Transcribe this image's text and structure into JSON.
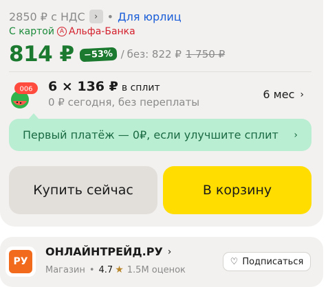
{
  "legal": {
    "price": "2850 ₽ с НДС",
    "link": "Для юрлиц",
    "separator": "•"
  },
  "bank_offer": {
    "prefix": "С картой",
    "bank_name": "Альфа-Банка"
  },
  "price": {
    "main": "814 ₽",
    "discount_badge": "−53%",
    "separator": "/",
    "without_label": "без: 822 ₽",
    "old_price": "1 750 ₽"
  },
  "split": {
    "icon_badge": "006",
    "amount": "6 × 136 ₽",
    "label": "в сплит",
    "subtitle": "0 ₽ сегодня, без переплаты",
    "months": "6 мес"
  },
  "banner": {
    "text": "Первый платёж — 0₽, если улучшите сплит"
  },
  "buttons": {
    "buy_now": "Купить сейчас",
    "add_to_cart": "В корзину"
  },
  "shop": {
    "logo_text": "РУ",
    "name": "ОНЛАЙНТРЕЙД.РУ",
    "type": "Магазин",
    "rating": "4.7",
    "reviews": "1.5M оценок",
    "subscribe": "Подписаться"
  },
  "colors": {
    "green": "#1b7a2f",
    "yellow": "#ffdd00",
    "banner_bg": "#b9eed2",
    "alfa_red": "#d4202c",
    "shop_orange": "#f26a1b"
  },
  "icons": {
    "chevron": "chevron-right-icon",
    "alfa": "alfa-bank-icon",
    "star": "star-icon",
    "heart": "heart-icon"
  }
}
